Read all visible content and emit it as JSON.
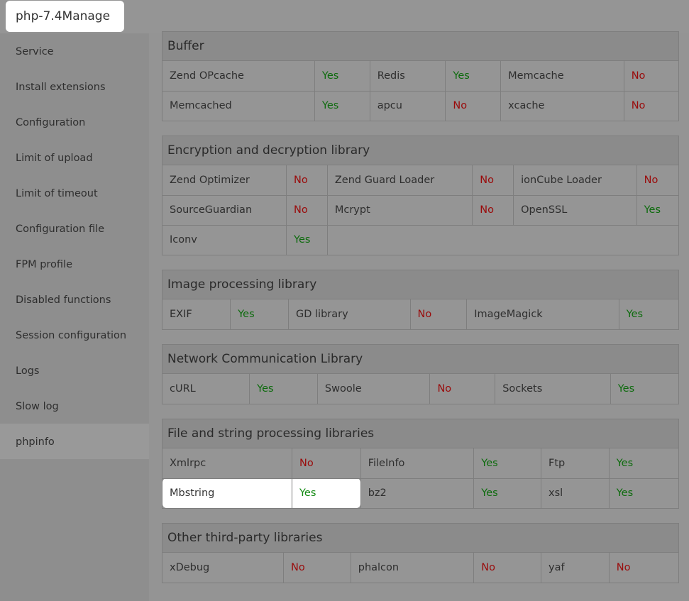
{
  "title": "php-7.4Manage",
  "sidebar": [
    "Service",
    "Install extensions",
    "Configuration",
    "Limit of upload",
    "Limit of timeout",
    "Configuration file",
    "FPM profile",
    "Disabled functions",
    "Session configuration",
    "Logs",
    "Slow log",
    "phpinfo"
  ],
  "active": "phpinfo",
  "sections": [
    {
      "title": "Buffer",
      "widths": [
        215,
        78,
        107,
        78,
        174,
        77
      ],
      "rows": [
        [
          [
            "Zend OPcache",
            "Yes"
          ],
          [
            "Redis",
            "Yes"
          ],
          [
            "Memcache",
            "No"
          ]
        ],
        [
          [
            "Memcached",
            "Yes"
          ],
          [
            "apcu",
            "No"
          ],
          [
            "xcache",
            "No"
          ]
        ]
      ]
    },
    {
      "title": "Encryption and decryption library",
      "widths": [
        175,
        58,
        205,
        58,
        174,
        59
      ],
      "rows": [
        [
          [
            "Zend Optimizer",
            "No"
          ],
          [
            "Zend Guard Loader",
            "No"
          ],
          [
            "ionCube Loader",
            "No"
          ]
        ],
        [
          [
            "SourceGuardian",
            "No"
          ],
          [
            "Mcrypt",
            "No"
          ],
          [
            "OpenSSL",
            "Yes"
          ]
        ],
        [
          [
            "Iconv",
            "Yes"
          ]
        ]
      ]
    },
    {
      "title": "Image processing library",
      "widths": [
        96,
        82,
        172,
        80,
        215,
        84
      ],
      "rows": [
        [
          [
            "EXIF",
            "Yes"
          ],
          [
            "GD library",
            "No"
          ],
          [
            "ImageMagick",
            "Yes"
          ]
        ]
      ]
    },
    {
      "title": "Network Communication Library",
      "widths": [
        123,
        96,
        159,
        92,
        163,
        96
      ],
      "rows": [
        [
          [
            "cURL",
            "Yes"
          ],
          [
            "Swoole",
            "No"
          ],
          [
            "Sockets",
            "Yes"
          ]
        ]
      ]
    },
    {
      "title": "File and string processing libraries",
      "widths": [
        183,
        97,
        160,
        95,
        96,
        98
      ],
      "rows": [
        [
          [
            "Xmlrpc",
            "No"
          ],
          [
            "FileInfo",
            "Yes"
          ],
          [
            "Ftp",
            "Yes"
          ]
        ],
        [
          [
            "Mbstring",
            "Yes"
          ],
          [
            "bz2",
            "Yes"
          ],
          [
            "xsl",
            "Yes"
          ]
        ]
      ]
    },
    {
      "title": "Other third-party libraries",
      "widths": [
        171,
        95,
        174,
        95,
        96,
        98
      ],
      "rows": [
        [
          [
            "xDebug",
            "No"
          ],
          [
            "phalcon",
            "No"
          ],
          [
            "yaf",
            "No"
          ]
        ]
      ]
    }
  ],
  "highlight": "Mbstring"
}
